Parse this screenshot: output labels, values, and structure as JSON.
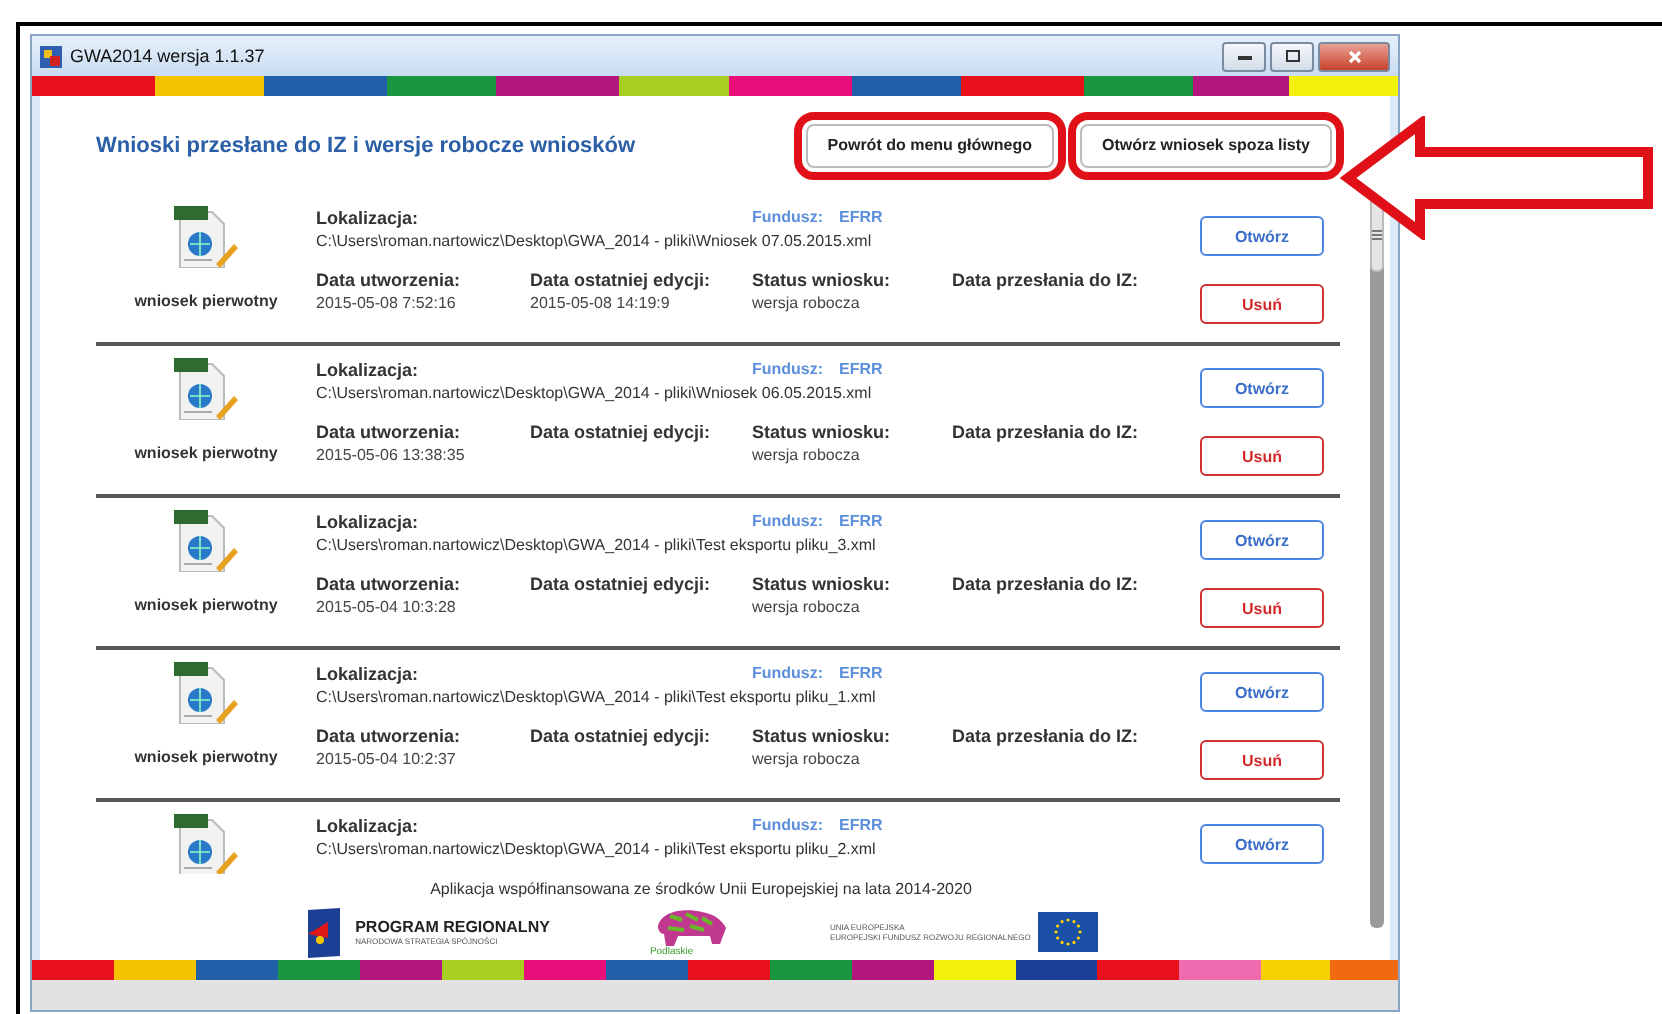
{
  "window": {
    "title": "GWA2014 wersja 1.1.37"
  },
  "header": {
    "title": "Wnioski przesłane do IZ i wersje robocze wniosków",
    "buttons": [
      {
        "label": "Powrót do menu głównego",
        "highlighted": true
      },
      {
        "label": "Otwórz wniosek spoza listy",
        "highlighted": true
      }
    ]
  },
  "rows": [
    {
      "type": "wniosek pierwotny",
      "location_label": "Lokalizacja:",
      "path": "C:\\Users\\roman.nartowicz\\Desktop\\GWA_2014 - pliki\\Wniosek 07.05.2015.xml",
      "fund_label": "Fundusz:",
      "fund": "EFRR",
      "created_label": "Data utworzenia:",
      "created": "2015-05-08 7:52:16",
      "edited_label": "Data ostatniej edycji:",
      "edited": "2015-05-08 14:19:9",
      "status_label": "Status wniosku:",
      "status": "wersja robocza",
      "sent_label": "Data przesłania do IZ:",
      "open": "Otwórz",
      "delete": "Usuń"
    },
    {
      "type": "wniosek pierwotny",
      "location_label": "Lokalizacja:",
      "path": "C:\\Users\\roman.nartowicz\\Desktop\\GWA_2014 - pliki\\Wniosek 06.05.2015.xml",
      "fund_label": "Fundusz:",
      "fund": "EFRR",
      "created_label": "Data utworzenia:",
      "created": "2015-05-06 13:38:35",
      "edited_label": "Data ostatniej edycji:",
      "status_label": "Status wniosku:",
      "status": "wersja robocza",
      "sent_label": "Data przesłania do IZ:",
      "open": "Otwórz",
      "delete": "Usuń"
    },
    {
      "type": "wniosek pierwotny",
      "location_label": "Lokalizacja:",
      "path": "C:\\Users\\roman.nartowicz\\Desktop\\GWA_2014 - pliki\\Test eksportu pliku_3.xml",
      "fund_label": "Fundusz:",
      "fund": "EFRR",
      "created_label": "Data utworzenia:",
      "created": "2015-05-04 10:3:28",
      "edited_label": "Data ostatniej edycji:",
      "status_label": "Status wniosku:",
      "status": "wersja robocza",
      "sent_label": "Data przesłania do IZ:",
      "open": "Otwórz",
      "delete": "Usuń"
    },
    {
      "type": "wniosek pierwotny",
      "location_label": "Lokalizacja:",
      "path": "C:\\Users\\roman.nartowicz\\Desktop\\GWA_2014 - pliki\\Test eksportu pliku_1.xml",
      "fund_label": "Fundusz:",
      "fund": "EFRR",
      "created_label": "Data utworzenia:",
      "created": "2015-05-04 10:2:37",
      "edited_label": "Data ostatniej edycji:",
      "status_label": "Status wniosku:",
      "status": "wersja robocza",
      "sent_label": "Data przesłania do IZ:",
      "open": "Otwórz",
      "delete": "Usuń"
    },
    {
      "location_label": "Lokalizacja:",
      "path": "C:\\Users\\roman.nartowicz\\Desktop\\GWA_2014 - pliki\\Test eksportu pliku_2.xml",
      "fund_label": "Fundusz:",
      "fund": "EFRR",
      "open": "Otwórz"
    }
  ],
  "footer": {
    "text": "Aplikacja współfinansowana ze środków Unii Europejskiej na lata 2014-2020",
    "logos": {
      "program": "PROGRAM REGIONALNY",
      "program_sub": "NARODOWA STRATEGIA SPÓJNOŚCI",
      "region": "Podlaskie",
      "eu": "UNIA EUROPEJSKA",
      "eu_sub": "EUROPEJSKI FUNDUSZ ROZWOJU REGIONALNEGO"
    }
  }
}
